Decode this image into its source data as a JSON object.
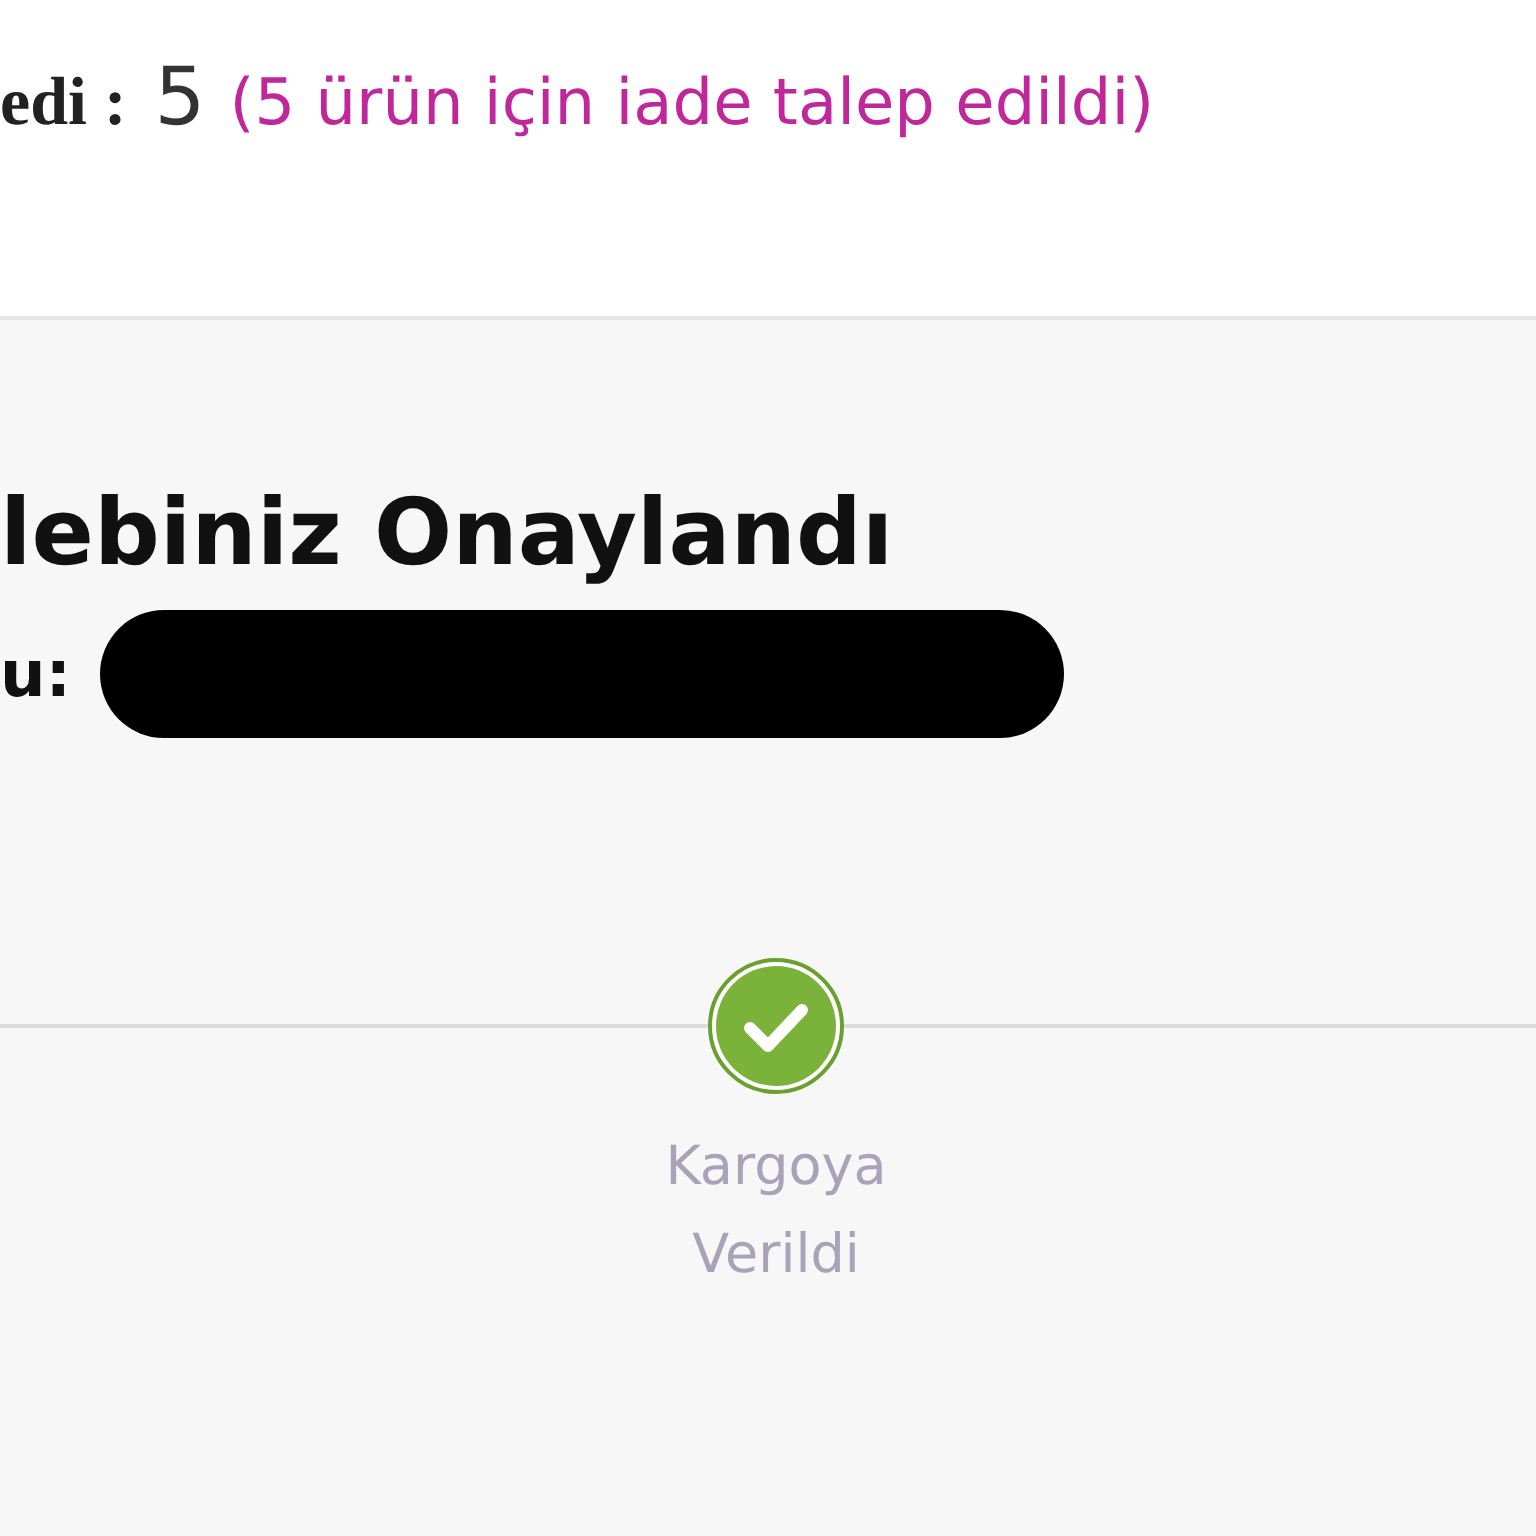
{
  "summary": {
    "label": "edi :",
    "value": "5",
    "note": "(5 ürün için iade talep edildi)"
  },
  "status": {
    "title": "lebiniz Onaylandı",
    "code_label": "u:",
    "code_redacted": true
  },
  "steps": [
    {
      "label": "Kargoya Verildi",
      "done": true
    }
  ]
}
